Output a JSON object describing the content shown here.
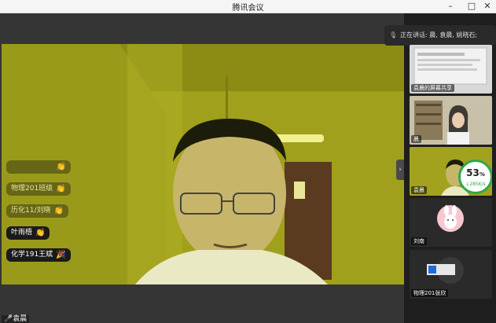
{
  "window": {
    "title": "腾讯会议",
    "minimize": "–",
    "maximize": "□",
    "close": "✕"
  },
  "speaking": {
    "label": "正在讲话: 晨, 袁晨, 姚晓石;"
  },
  "reactions": [
    {
      "name": "",
      "active": false
    },
    {
      "name": "物理201班级",
      "active": false
    },
    {
      "name": "历化11/刘晓",
      "active": false
    },
    {
      "name": "叶雨梧",
      "active": true
    },
    {
      "name": "化学191王斌",
      "active": true
    }
  ],
  "bottom_name": "袁晨",
  "thumbs": [
    {
      "label": "袁晨的屏幕共享"
    },
    {
      "label": "晨"
    },
    {
      "label": "袁晨"
    },
    {
      "label": "刘南"
    },
    {
      "label": "物理201张欣"
    }
  ],
  "network": {
    "percent": "53",
    "unit": "%",
    "speed": "↓285K/s"
  },
  "colors": {
    "video_tint": "#9b9b1a",
    "sidebar": "#1e1e1e",
    "stage": "#353535",
    "ok_green": "#2ea84a"
  }
}
